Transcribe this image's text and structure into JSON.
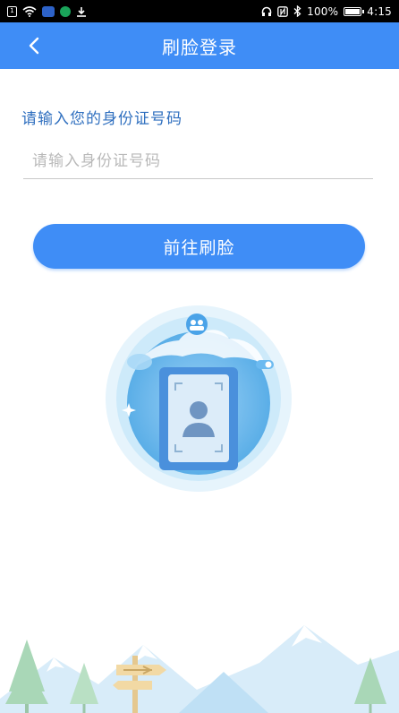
{
  "status_bar": {
    "battery_percent": "100%",
    "time": "4:15"
  },
  "nav": {
    "title": "刷脸登录",
    "back_icon": "chevron-left-icon"
  },
  "form": {
    "id_label": "请输入您的身份证号码",
    "id_placeholder": "请输入身份证号码",
    "id_value": ""
  },
  "actions": {
    "go_face_label": "前往刷脸"
  },
  "colors": {
    "brand": "#3f8df6",
    "label": "#2f6fbf",
    "placeholder": "#b9b9b9"
  },
  "illustration": {
    "icon": "face-id-card-illustration"
  },
  "footer": {
    "icon": "mountain-landscape-illustration"
  }
}
